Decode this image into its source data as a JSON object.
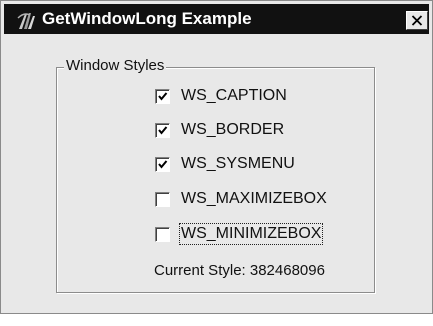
{
  "window": {
    "title": "GetWindowLong Example",
    "close_icon": "close-icon",
    "app_icon": "app-logo-icon"
  },
  "group": {
    "label": "Window Styles",
    "items": [
      {
        "label": "WS_CAPTION",
        "checked": true
      },
      {
        "label": "WS_BORDER",
        "checked": true
      },
      {
        "label": "WS_SYSMENU",
        "checked": true
      },
      {
        "label": "WS_MAXIMIZEBOX",
        "checked": false
      },
      {
        "label": "WS_MINIMIZEBOX",
        "checked": false,
        "focused": true
      }
    ]
  },
  "status": {
    "text": "Current Style: 382468096"
  }
}
